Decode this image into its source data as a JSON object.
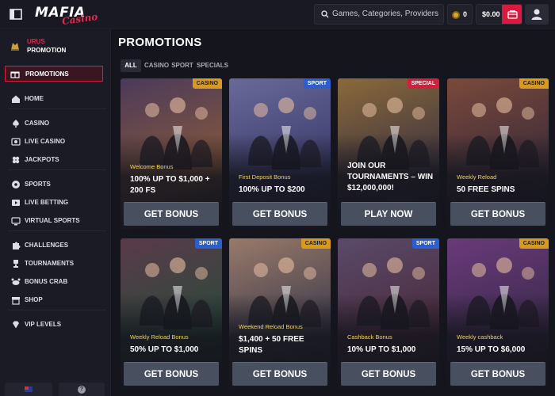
{
  "header": {
    "logo_main": "MAFIA",
    "logo_sub": "Casino",
    "search_placeholder": "Games, Categories, Providers",
    "coins_count": "0",
    "balance": "$0.00"
  },
  "sidebar": {
    "user": {
      "name": "URUS",
      "role": "PROMOTION"
    },
    "active_item": "PROMOTIONS",
    "groups": [
      [
        "HOME"
      ],
      [
        "CASINO",
        "LIVE CASINO",
        "JACKPOTS"
      ],
      [
        "SPORTS",
        "LIVE BETTING",
        "VIRTUAL SPORTS"
      ],
      [
        "CHALLENGES",
        "TOURNAMENTS",
        "BONUS CRAB",
        "SHOP"
      ],
      [
        "VIP LEVELS"
      ]
    ]
  },
  "main": {
    "title": "PROMOTIONS",
    "filters": [
      "ALL",
      "CASINO",
      "SPORT",
      "SPECIALS"
    ],
    "active_filter": "ALL",
    "cards": [
      {
        "badge": "CASINO",
        "badge_type": "casino",
        "subtitle": "Welcome Bonus",
        "headline": "100% UP TO $1,000 + 200 FS",
        "cta": "GET BONUS",
        "palette": [
          "#4a3a5a",
          "#8a5a3a"
        ]
      },
      {
        "badge": "SPORT",
        "badge_type": "sport",
        "subtitle": "First Deposit Bonus",
        "headline": "100% UP TO $200",
        "cta": "GET BONUS",
        "palette": [
          "#6a6a9a",
          "#3a3a6a"
        ]
      },
      {
        "badge": "SPECIAL",
        "badge_type": "special",
        "subtitle": "",
        "headline": "JOIN OUR TOURNAMENTS – WIN $12,000,000!",
        "cta": "PLAY NOW",
        "palette": [
          "#8a6a3a",
          "#3a3040"
        ]
      },
      {
        "badge": "CASINO",
        "badge_type": "casino",
        "subtitle": "Weekly Reload",
        "headline": "50 FREE SPINS",
        "cta": "GET BONUS",
        "palette": [
          "#7a4a3a",
          "#3a2a3a"
        ]
      },
      {
        "badge": "SPORT",
        "badge_type": "sport",
        "subtitle": "Weekly Reload Bonus",
        "headline": "50% UP TO $1,000",
        "cta": "GET BONUS",
        "palette": [
          "#5a3a4a",
          "#2a4a3a"
        ]
      },
      {
        "badge": "CASINO",
        "badge_type": "casino",
        "subtitle": "Weekend Reload Bonus",
        "headline": "$1,400 + 50 FREE SPINS",
        "cta": "GET BONUS",
        "palette": [
          "#9a7a6a",
          "#3a3a4a"
        ]
      },
      {
        "badge": "SPORT",
        "badge_type": "sport",
        "subtitle": "Cashback Bonus",
        "headline": "10% UP TO $1,000",
        "cta": "GET BONUS",
        "palette": [
          "#5a4a6a",
          "#4a2a3a"
        ]
      },
      {
        "badge": "CASINO",
        "badge_type": "casino",
        "subtitle": "Weekly cashback",
        "headline": "15% UP TO $6,000",
        "cta": "GET BONUS",
        "palette": [
          "#6a3a7a",
          "#3a2a4a"
        ]
      }
    ]
  },
  "colors": {
    "accent": "#d9193d",
    "casino_badge": "#d99a1c",
    "sport_badge": "#2b5fd0",
    "special_badge": "#d41f3c",
    "subtitle_gold": "#f2d35a"
  }
}
